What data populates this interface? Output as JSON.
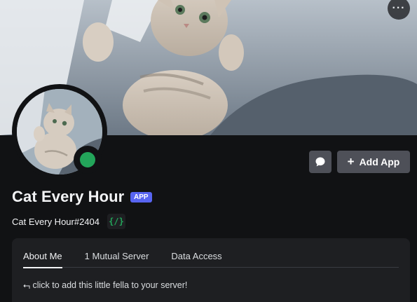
{
  "header": {
    "more_label": "···"
  },
  "profile": {
    "display_name": "Cat Every Hour",
    "app_badge": "APP",
    "username": "Cat Every Hour#2404",
    "dev_badge": "{/}",
    "status_color": "#23a55a"
  },
  "actions": {
    "message_icon": "chat-bubble-icon",
    "add_app_icon": "plus-icon",
    "add_app_label": "Add App"
  },
  "tabs": [
    {
      "label": "About Me",
      "active": true
    },
    {
      "label": "1 Mutual Server",
      "active": false
    },
    {
      "label": "Data Access",
      "active": false
    }
  ],
  "about": {
    "text": "⮢ click to add this little fella to your server!"
  },
  "colors": {
    "background": "#111214",
    "panel": "#1e1f22",
    "button": "#4e5058",
    "accent": "#5865f2",
    "online": "#23a55a"
  }
}
